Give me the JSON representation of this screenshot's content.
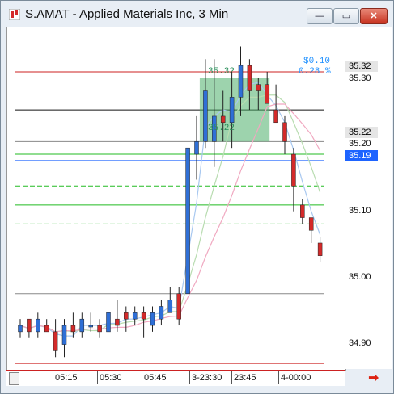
{
  "window": {
    "title": "S.AMAT - Applied Materials Inc, 3 Min"
  },
  "buttons": {
    "minimize": "—",
    "maximize": "▭",
    "close": "✕"
  },
  "yaxis": {
    "ticks": [
      "35.30",
      "35.20",
      "35.10",
      "35.00",
      "34.90"
    ],
    "badges": {
      "hi": "35.32",
      "lo": "35.22",
      "last": "35.19"
    }
  },
  "xaxis": {
    "labels": [
      "05:15",
      "05:30",
      "05:45",
      "3-23:30",
      "23:45",
      "4-00:00"
    ]
  },
  "measure": {
    "delta": "$0.10",
    "pct": "0.28 %",
    "top": "35.32",
    "bottom": "35.22"
  },
  "chart_data": {
    "type": "candlestick",
    "ylim": [
      34.86,
      35.4
    ],
    "candles": [
      [
        34.92,
        34.94,
        34.91,
        34.93
      ],
      [
        34.94,
        34.94,
        34.91,
        34.92
      ],
      [
        34.92,
        34.95,
        34.91,
        34.94
      ],
      [
        34.93,
        34.94,
        34.92,
        34.92
      ],
      [
        34.92,
        34.94,
        34.88,
        34.89
      ],
      [
        34.9,
        34.94,
        34.88,
        34.93
      ],
      [
        34.93,
        34.95,
        34.91,
        34.92
      ],
      [
        34.92,
        34.95,
        34.91,
        34.94
      ],
      [
        34.93,
        34.95,
        34.92,
        34.93
      ],
      [
        34.93,
        34.94,
        34.91,
        34.92
      ],
      [
        34.92,
        34.95,
        34.92,
        34.95
      ],
      [
        34.94,
        34.97,
        34.92,
        34.93
      ],
      [
        34.95,
        34.96,
        34.92,
        34.94
      ],
      [
        34.94,
        34.96,
        34.93,
        34.95
      ],
      [
        34.95,
        34.96,
        34.91,
        34.94
      ],
      [
        34.93,
        34.96,
        34.92,
        34.95
      ],
      [
        34.94,
        34.97,
        34.93,
        34.96
      ],
      [
        34.95,
        34.99,
        34.95,
        34.97
      ],
      [
        34.98,
        34.99,
        34.93,
        34.94
      ],
      [
        34.98,
        35.21,
        34.98,
        35.21
      ],
      [
        35.2,
        35.26,
        35.16,
        35.22
      ],
      [
        35.22,
        35.35,
        35.21,
        35.3
      ],
      [
        35.22,
        35.35,
        35.18,
        35.26
      ],
      [
        35.26,
        35.3,
        35.22,
        35.25
      ],
      [
        35.25,
        35.33,
        35.21,
        35.29
      ],
      [
        35.29,
        35.37,
        35.26,
        35.34
      ],
      [
        35.34,
        35.35,
        35.27,
        35.3
      ],
      [
        35.31,
        35.32,
        35.27,
        35.3
      ],
      [
        35.31,
        35.33,
        35.29,
        35.28
      ],
      [
        35.27,
        35.31,
        35.26,
        35.25
      ],
      [
        35.25,
        35.26,
        35.2,
        35.22
      ],
      [
        35.2,
        35.21,
        35.11,
        35.15
      ],
      [
        35.12,
        35.13,
        35.09,
        35.1
      ],
      [
        35.1,
        35.1,
        35.06,
        35.08
      ],
      [
        35.06,
        35.07,
        35.03,
        35.04
      ]
    ],
    "hlines": [
      {
        "y": 35.33,
        "color": "#cc2222"
      },
      {
        "y": 35.27,
        "color": "#111111"
      },
      {
        "y": 35.22,
        "color": "#888888"
      },
      {
        "y": 35.2,
        "color": "#22bb22"
      },
      {
        "y": 35.19,
        "color": "#1e64ff"
      },
      {
        "y": 35.15,
        "color": "#22bb22",
        "dash": true
      },
      {
        "y": 35.12,
        "color": "#22bb22"
      },
      {
        "y": 35.09,
        "color": "#22bb22",
        "dash": true
      },
      {
        "y": 34.98,
        "color": "#888888"
      },
      {
        "y": 34.87,
        "color": "#cc2222"
      }
    ]
  },
  "colors": {
    "up": "#2f6fd6",
    "down": "#d42a2a",
    "ma1": "#a8c8f0",
    "ma2": "#b8dcb0",
    "ma3": "#f0a8c0"
  }
}
